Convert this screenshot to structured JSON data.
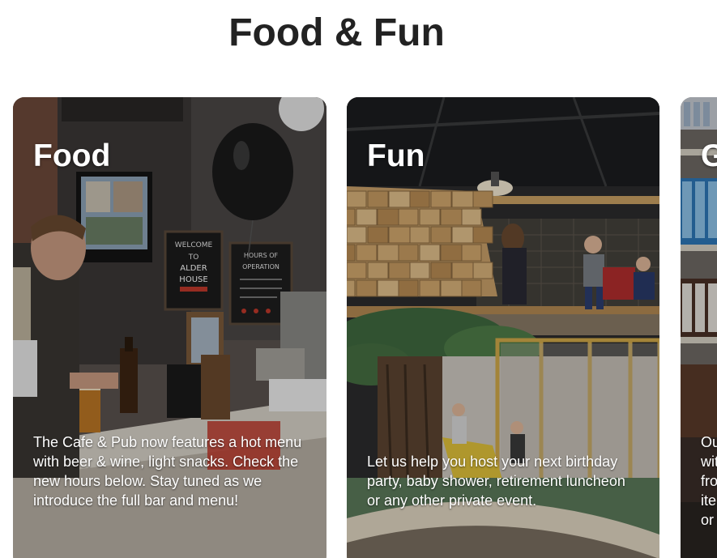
{
  "section": {
    "title": "Food & Fun"
  },
  "cards": [
    {
      "heading": "Food",
      "text": "The Cafe & Pub now features a hot menu with beer & wine, light snacks. Check the new hours below. Stay tuned as we introduce the full bar and menu!",
      "sign_left_text": "WELCOME TO ALDER HOUSE",
      "sign_right_text": "HOURS OF OPERATION",
      "photo_subject": "cafe-pub-counter-photo"
    },
    {
      "heading": "Fun",
      "text": "Let us help you host your next birthday party, baby shower, retirement luncheon or any other private event.",
      "photo_subject": "indoor-playground-photo"
    },
    {
      "heading": "G",
      "text_lines": [
        "Ou",
        "wit",
        "fro",
        "ite",
        "or "
      ],
      "photo_subject": "shop-shelves-photo"
    }
  ],
  "colors": {
    "title": "#222222",
    "card_text": "#ffffff"
  }
}
